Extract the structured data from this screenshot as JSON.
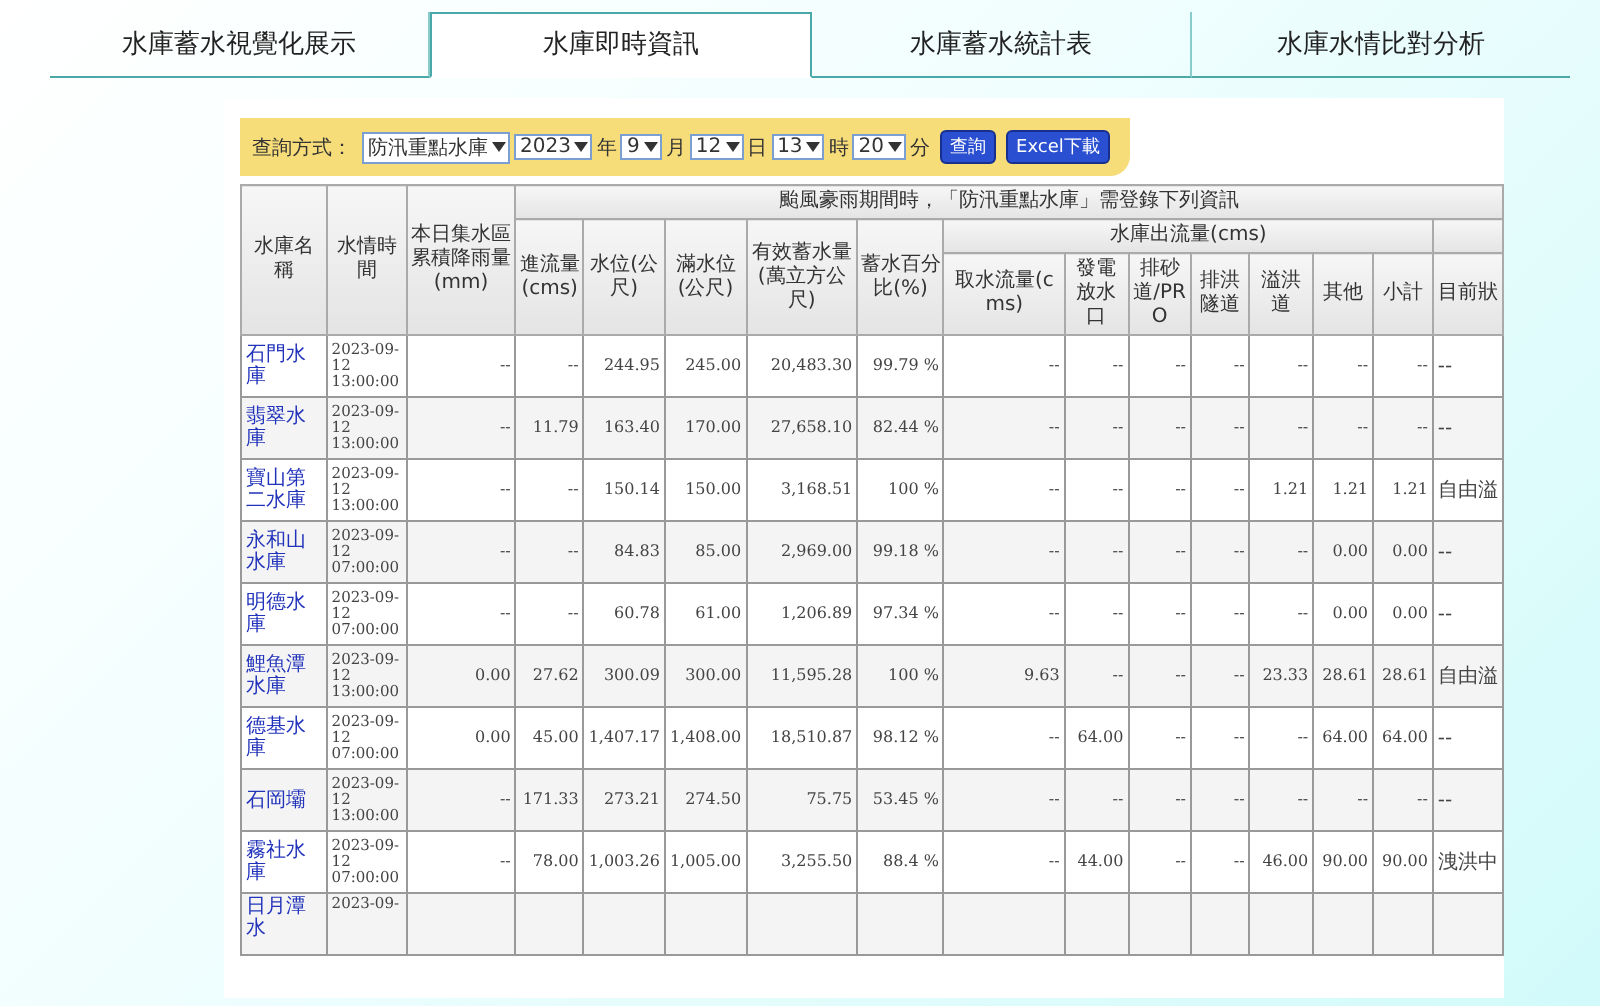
{
  "tabs": [
    {
      "label": "水庫蓄水視覺化展示",
      "selected": false
    },
    {
      "label": "水庫即時資訊",
      "selected": true
    },
    {
      "label": "水庫蓄水統計表",
      "selected": false
    },
    {
      "label": "水庫水情比對分析",
      "selected": false
    }
  ],
  "query": {
    "label": "查詢方式：",
    "mode": "防汛重點水庫",
    "date_parts": [
      {
        "value": "2023",
        "unit": "年"
      },
      {
        "value": "9",
        "unit": "月"
      },
      {
        "value": "12",
        "unit": "日"
      },
      {
        "value": "13",
        "unit": "時"
      },
      {
        "value": "20",
        "unit": "分"
      }
    ],
    "buttons": [
      "查詢",
      "Excel下載"
    ]
  },
  "table": {
    "columns": {
      "name": "水庫名稱",
      "time": "水情時間",
      "rain": "本日集水區累積降雨量(mm)",
      "banner": "颱風豪雨期間時，「防汛重點水庫」需登錄下列資訊",
      "basic": [
        "進流量(cms)",
        "水位(公尺)",
        "滿水位(公尺)",
        "有效蓄水量(萬立方公尺)",
        "蓄水百分比(%)"
      ],
      "outflow_group": "水庫出流量(cms)",
      "outflow": [
        "取水流量(cms)",
        "發電放水口",
        "排砂道/PRO",
        "排洪隧道",
        "溢洪道",
        "其他",
        "小計"
      ],
      "status": "目前狀"
    },
    "rows": [
      {
        "name": "石門水庫",
        "time": "2023-09-12 13:00:00",
        "cells": [
          "--",
          "--",
          "244.95",
          "245.00",
          "20,483.30",
          "99.79 %",
          "--",
          "--",
          "--",
          "--",
          "--",
          "--",
          "--",
          "--"
        ]
      },
      {
        "name": "翡翠水庫",
        "time": "2023-09-12 13:00:00",
        "cells": [
          "--",
          "11.79",
          "163.40",
          "170.00",
          "27,658.10",
          "82.44 %",
          "--",
          "--",
          "--",
          "--",
          "--",
          "--",
          "--",
          "--"
        ]
      },
      {
        "name": "寶山第二水庫",
        "time": "2023-09-12 13:00:00",
        "cells": [
          "--",
          "--",
          "150.14",
          "150.00",
          "3,168.51",
          "100 %",
          "--",
          "--",
          "--",
          "--",
          "1.21",
          "1.21",
          "1.21",
          "自由溢"
        ]
      },
      {
        "name": "永和山水庫",
        "time": "2023-09-12 07:00:00",
        "cells": [
          "--",
          "--",
          "84.83",
          "85.00",
          "2,969.00",
          "99.18 %",
          "--",
          "--",
          "--",
          "--",
          "--",
          "0.00",
          "0.00",
          "--"
        ]
      },
      {
        "name": "明德水庫",
        "time": "2023-09-12 07:00:00",
        "cells": [
          "--",
          "--",
          "60.78",
          "61.00",
          "1,206.89",
          "97.34 %",
          "--",
          "--",
          "--",
          "--",
          "--",
          "0.00",
          "0.00",
          "--"
        ]
      },
      {
        "name": "鯉魚潭水庫",
        "time": "2023-09-12 13:00:00",
        "cells": [
          "0.00",
          "27.62",
          "300.09",
          "300.00",
          "11,595.28",
          "100 %",
          "9.63",
          "--",
          "--",
          "--",
          "23.33",
          "28.61",
          "28.61",
          "自由溢"
        ]
      },
      {
        "name": "德基水庫",
        "time": "2023-09-12 07:00:00",
        "cells": [
          "0.00",
          "45.00",
          "1,407.17",
          "1,408.00",
          "18,510.87",
          "98.12 %",
          "--",
          "64.00",
          "--",
          "--",
          "--",
          "64.00",
          "64.00",
          "--"
        ]
      },
      {
        "name": "石岡壩",
        "time": "2023-09-12 13:00:00",
        "cells": [
          "--",
          "171.33",
          "273.21",
          "274.50",
          "75.75",
          "53.45 %",
          "--",
          "--",
          "--",
          "--",
          "--",
          "--",
          "--",
          "--"
        ]
      },
      {
        "name": "霧社水庫",
        "time": "2023-09-12 07:00:00",
        "cells": [
          "--",
          "78.00",
          "1,003.26",
          "1,005.00",
          "3,255.50",
          "88.4 %",
          "--",
          "44.00",
          "--",
          "--",
          "46.00",
          "90.00",
          "90.00",
          "洩洪中"
        ]
      },
      {
        "name": "日月潭水",
        "time": "2023-09-",
        "cells": []
      }
    ]
  }
}
